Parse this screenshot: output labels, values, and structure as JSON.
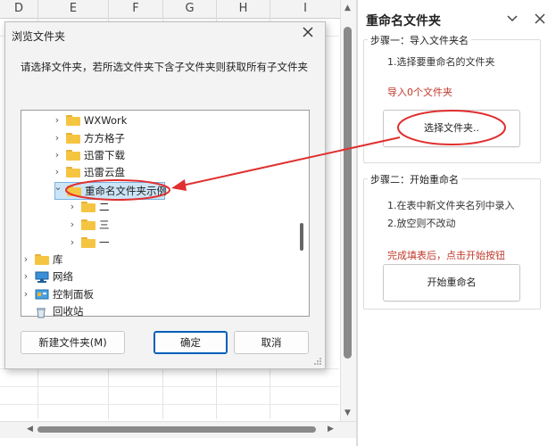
{
  "columns": [
    "D",
    "E",
    "F",
    "G",
    "H",
    "I"
  ],
  "dialog": {
    "title": "浏览文件夹",
    "instruction": "请选择文件夹，若所选文件夹下含子文件夹则获取所有子文件夹",
    "tree": [
      {
        "label": "WXWork",
        "icon": "folder-icon",
        "expander": "chevron-right-icon"
      },
      {
        "label": "方方格子",
        "icon": "folder-icon",
        "expander": "chevron-right-icon"
      },
      {
        "label": "迅雷下载",
        "icon": "folder-icon",
        "expander": "chevron-right-icon"
      },
      {
        "label": "迅雷云盘",
        "icon": "folder-icon",
        "expander": "chevron-right-icon"
      },
      {
        "label": "重命名文件夹示例",
        "icon": "folder-icon",
        "expander": "chevron-down-icon",
        "selected": true
      },
      {
        "label": "二",
        "icon": "folder-icon",
        "expander": "chevron-right-icon"
      },
      {
        "label": "三",
        "icon": "folder-icon",
        "expander": "chevron-right-icon"
      },
      {
        "label": "一",
        "icon": "folder-icon",
        "expander": "chevron-right-icon"
      },
      {
        "label": "库",
        "icon": "folder-icon",
        "expander": "chevron-right-icon"
      },
      {
        "label": "网络",
        "icon": "network-icon",
        "expander": "chevron-right-icon"
      },
      {
        "label": "控制面板",
        "icon": "control-panel-icon",
        "expander": "chevron-right-icon"
      },
      {
        "label": "回收站",
        "icon": "recycle-bin-icon",
        "expander": ""
      }
    ],
    "new_folder_label": "新建文件夹(M)",
    "ok_label": "确定",
    "cancel_label": "取消"
  },
  "pane": {
    "title": "重命名文件夹",
    "step1": {
      "label": "步骤一：导入文件夹名",
      "instruction": "1.选择要重命名的文件夹",
      "status": "导入0个文件夹",
      "button": "选择文件夹.."
    },
    "step2": {
      "label": "步骤二：开始重命名",
      "line1": "1.在表中新文件夹名列中录入",
      "line2": "2.放空则不改动",
      "hint": "完成填表后，点击开始按钮",
      "button": "开始重命名"
    }
  },
  "colors": {
    "annotation_red": "#e03030",
    "selection_bg": "#cce4f7",
    "folder_yellow": "#f5c542",
    "status_red": "#c0392b",
    "ok_border": "#005fb8"
  }
}
